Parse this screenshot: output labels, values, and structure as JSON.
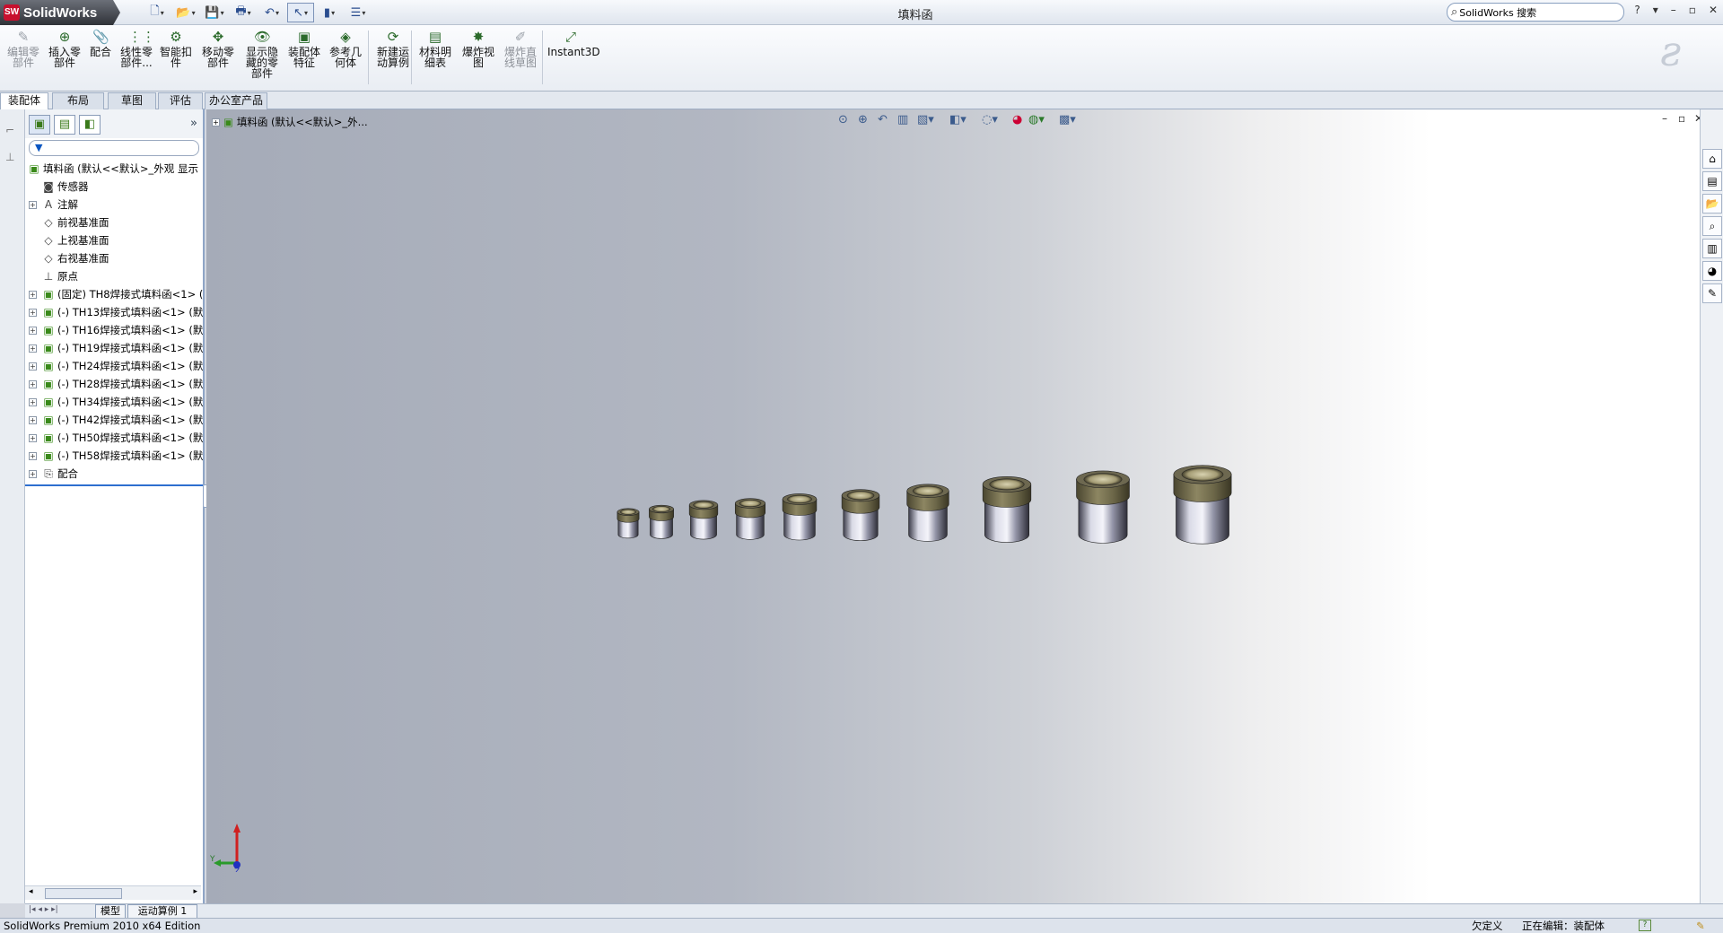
{
  "app": {
    "logo_text": "SolidWorks",
    "logo_badge": "SW",
    "window_title": "填料函",
    "search_placeholder": "SolidWorks 搜索",
    "window_buttons": [
      "?",
      "▾",
      "–",
      "▫",
      "✕"
    ]
  },
  "quick_access": [
    {
      "icon": "new-icon",
      "glyph": "🗋"
    },
    {
      "icon": "open-icon",
      "glyph": "📂"
    },
    {
      "icon": "save-icon",
      "glyph": "💾"
    },
    {
      "icon": "print-icon",
      "glyph": "🖶"
    },
    {
      "icon": "undo-icon",
      "glyph": "↶"
    },
    {
      "icon": "select-icon",
      "glyph": "↖"
    },
    {
      "icon": "rebuild-icon",
      "glyph": "▮"
    },
    {
      "icon": "options-icon",
      "glyph": "☰"
    }
  ],
  "ribbon": {
    "items": [
      {
        "label": "编辑零\n部件",
        "glyph": "✎",
        "disabled": true
      },
      {
        "label": "插入零\n部件",
        "glyph": "⊕",
        "disabled": false
      },
      {
        "label": "配合",
        "glyph": "📎",
        "disabled": false
      },
      {
        "label": "线性零\n部件...",
        "glyph": "⋮⋮",
        "disabled": false
      },
      {
        "label": "智能扣\n件",
        "glyph": "⚙",
        "disabled": false
      },
      {
        "label": "移动零\n部件",
        "glyph": "✥",
        "disabled": false
      },
      {
        "label": "显示隐\n藏的零\n部件",
        "glyph": "👁",
        "disabled": false
      },
      {
        "label": "装配体\n特征",
        "glyph": "▣",
        "disabled": false
      },
      {
        "label": "参考几\n何体",
        "glyph": "◈",
        "disabled": false
      },
      {
        "label": "新建运\n动算例",
        "glyph": "⟳",
        "disabled": false
      },
      {
        "label": "材料明\n细表",
        "glyph": "▤",
        "disabled": false
      },
      {
        "label": "爆炸视\n图",
        "glyph": "✸",
        "disabled": false
      },
      {
        "label": "爆炸直\n线草图",
        "glyph": "✐",
        "disabled": true
      },
      {
        "label": "Instant3D",
        "glyph": "⤢",
        "disabled": false
      }
    ]
  },
  "tabs": [
    "装配体",
    "布局",
    "草图",
    "评估",
    "办公室产品"
  ],
  "active_tab": "装配体",
  "feature_tree": {
    "filter_glyph": "▼",
    "root": "填料函 (默认<<默认>_外观 显示",
    "items": [
      {
        "label": "传感器",
        "glyph": "◙",
        "expand": false,
        "indent": 1
      },
      {
        "label": "注解",
        "glyph": "A",
        "expand": true,
        "indent": 1
      },
      {
        "label": "前视基准面",
        "glyph": "◇",
        "expand": false,
        "indent": 1
      },
      {
        "label": "上视基准面",
        "glyph": "◇",
        "expand": false,
        "indent": 1
      },
      {
        "label": "右视基准面",
        "glyph": "◇",
        "expand": false,
        "indent": 1
      },
      {
        "label": "原点",
        "glyph": "⊥",
        "expand": false,
        "indent": 1
      },
      {
        "label": "(固定) TH8焊接式填料函<1> (",
        "glyph": "▣",
        "expand": true,
        "indent": 1
      },
      {
        "label": "(-) TH13焊接式填料函<1> (默",
        "glyph": "▣",
        "expand": true,
        "indent": 1
      },
      {
        "label": "(-) TH16焊接式填料函<1> (默",
        "glyph": "▣",
        "expand": true,
        "indent": 1
      },
      {
        "label": "(-) TH19焊接式填料函<1> (默",
        "glyph": "▣",
        "expand": true,
        "indent": 1
      },
      {
        "label": "(-) TH24焊接式填料函<1> (默",
        "glyph": "▣",
        "expand": true,
        "indent": 1
      },
      {
        "label": "(-) TH28焊接式填料函<1> (默",
        "glyph": "▣",
        "expand": true,
        "indent": 1
      },
      {
        "label": "(-) TH34焊接式填料函<1> (默",
        "glyph": "▣",
        "expand": true,
        "indent": 1
      },
      {
        "label": "(-) TH42焊接式填料函<1> (默",
        "glyph": "▣",
        "expand": true,
        "indent": 1
      },
      {
        "label": "(-) TH50焊接式填料函<1> (默",
        "glyph": "▣",
        "expand": true,
        "indent": 1
      },
      {
        "label": "(-) TH58焊接式填料函<1> (默",
        "glyph": "▣",
        "expand": true,
        "indent": 1
      },
      {
        "label": "配合",
        "glyph": "⎘",
        "expand": true,
        "indent": 1
      }
    ]
  },
  "viewport": {
    "breadcrumb": "填料函 (默认<<默认>_外...",
    "triad": {
      "y": "Y",
      "z": "Z"
    },
    "parts": [
      {
        "name": "TH8",
        "scale": 0.55
      },
      {
        "name": "TH13",
        "scale": 0.62
      },
      {
        "name": "TH16",
        "scale": 0.72
      },
      {
        "name": "TH19",
        "scale": 0.76
      },
      {
        "name": "TH24",
        "scale": 0.86
      },
      {
        "name": "TH28",
        "scale": 0.95
      },
      {
        "name": "TH34",
        "scale": 1.06
      },
      {
        "name": "TH42",
        "scale": 1.22
      },
      {
        "name": "TH50",
        "scale": 1.34
      },
      {
        "name": "TH58",
        "scale": 1.46
      }
    ]
  },
  "bottom_tabs": [
    "模型",
    "运动算例 1"
  ],
  "status": {
    "edition": "SolidWorks Premium 2010 x64 Edition",
    "under_defined": "欠定义",
    "editing": "正在编辑：装配体",
    "help": "?"
  },
  "colors": {
    "accent": "#2e6fcf",
    "part_metal": "#8b8bb0",
    "part_brass": "#6e6a50"
  }
}
